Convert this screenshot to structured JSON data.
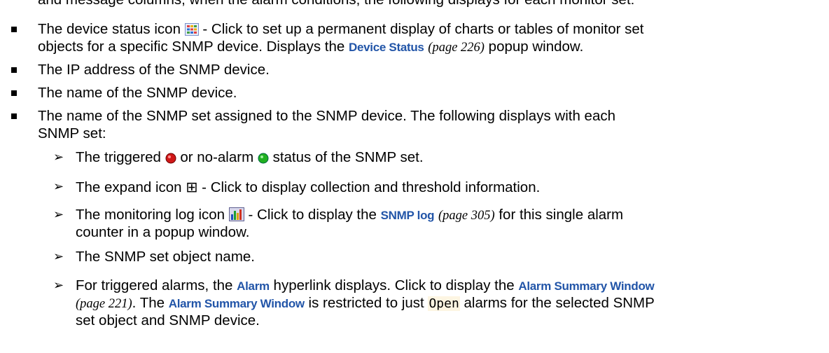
{
  "partial_top": "and message columns, when the alarm conditions, the following displays for each monitor set:",
  "bullets": [
    {
      "pre": "The device status icon",
      "icon": "device-status-icon",
      "mid": "- Click to set up a permanent display of charts or tables of monitor set",
      "line2_pre": "objects for a specific SNMP device. Displays the",
      "link": "Device Status",
      "page_ref": "(page 226)",
      "post": "popup window."
    },
    {
      "text": "The IP address of the SNMP device."
    },
    {
      "text": "The name of the SNMP device."
    },
    {
      "line1": "The name of the SNMP set assigned to the SNMP device. The following displays with each",
      "line2": "SNMP set:"
    }
  ],
  "sub_bullets": [
    {
      "pre": "The triggered",
      "mid": "or no-alarm",
      "post": "status of the SNMP set.",
      "icon_red": "red-status-icon",
      "icon_green": "green-status-icon"
    },
    {
      "pre": "The expand icon",
      "icon": "expand-icon",
      "glyph": "⊞",
      "post": "- Click to display collection and threshold information."
    },
    {
      "pre": "The monitoring log icon",
      "icon": "monitoring-log-icon",
      "mid": "- Click to display the",
      "link": "SNMP log",
      "page_ref": "(page 305)",
      "post": "for this single alarm",
      "line2": "counter in a popup window."
    },
    {
      "text": "The SNMP set object name."
    },
    {
      "pre": "For triggered alarms, the",
      "link1": "Alarm",
      "mid": "hyperlink displays. Click to display the",
      "link2": "Alarm Summary Window",
      "page_ref": "(page 221)",
      "mid2": ". The",
      "link3": "Alarm Summary Window",
      "mid3": "is restricted to just",
      "code": "Open",
      "post": "alarms for the selected SNMP",
      "line3": "set object and SNMP device."
    }
  ],
  "colors": {
    "link": "#2255a8",
    "code_bg": "#fdf5e2"
  }
}
